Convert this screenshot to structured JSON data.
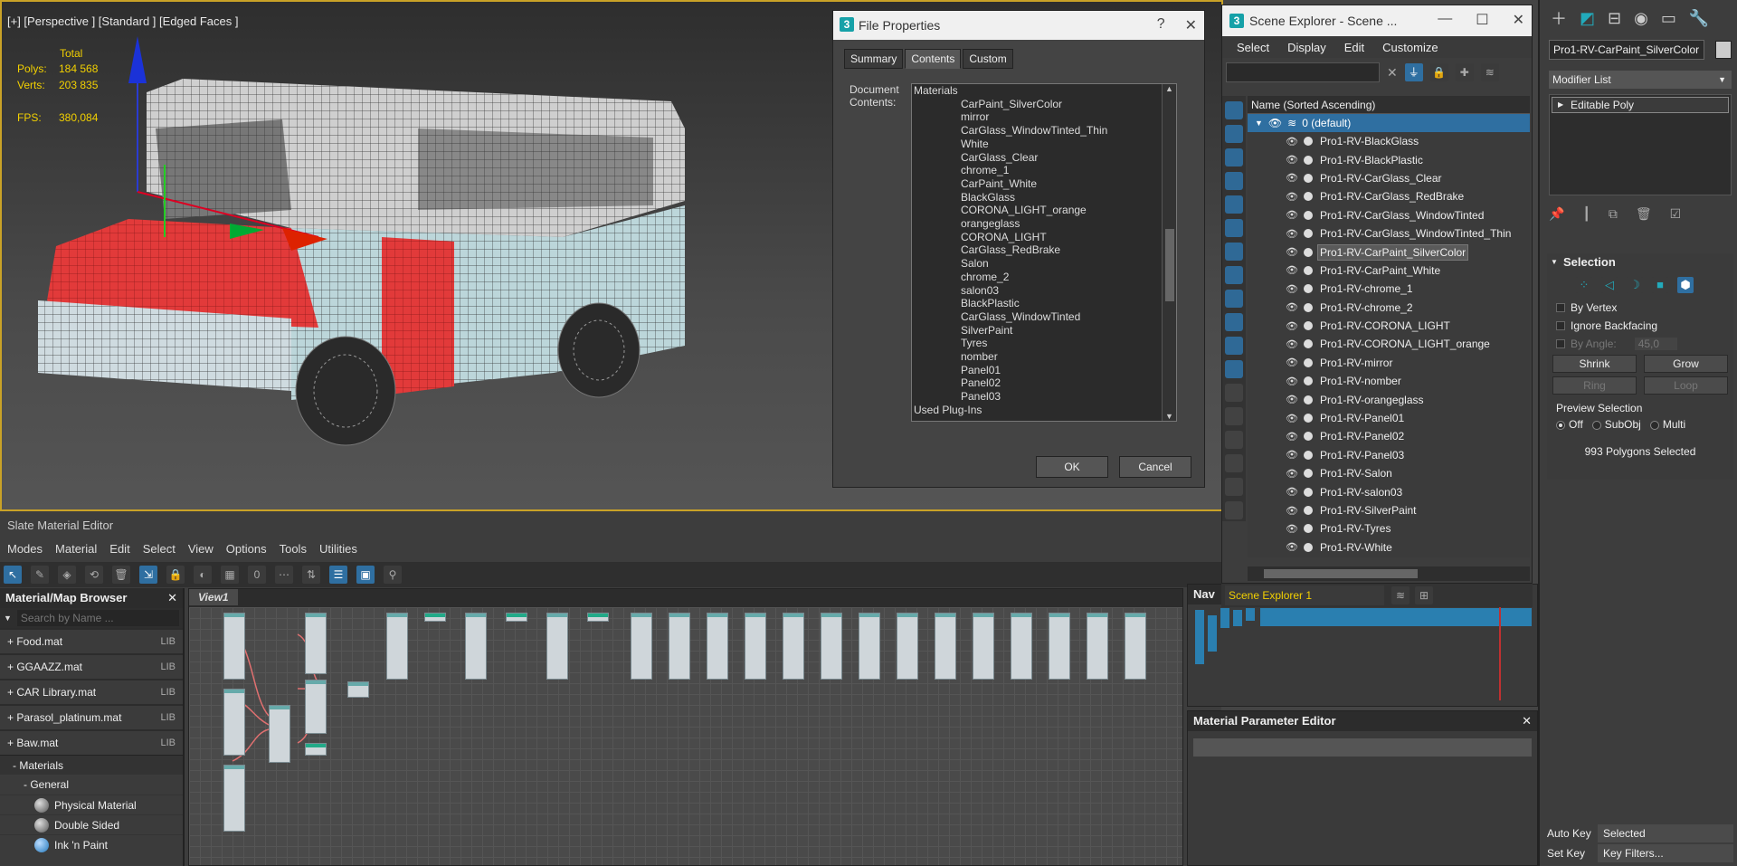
{
  "viewport": {
    "label": "[+] [Perspective ] [Standard ] [Edged Faces ]",
    "stats": {
      "total_label": "Total",
      "polys_label": "Polys:",
      "polys": "184 568",
      "verts_label": "Verts:",
      "verts": "203 835",
      "fps_label": "FPS:",
      "fps": "380,084"
    }
  },
  "file_properties": {
    "title": "File Properties",
    "help": "?",
    "close": "✕",
    "tabs": [
      "Summary",
      "Contents",
      "Custom"
    ],
    "active_tab": "Contents",
    "doc_label": "Document Contents:",
    "items": [
      {
        "text": "Materials",
        "kind": "head"
      },
      {
        "text": "CarPaint_SilverColor",
        "kind": "child"
      },
      {
        "text": "mirror",
        "kind": "child"
      },
      {
        "text": "CarGlass_WindowTinted_Thin",
        "kind": "child"
      },
      {
        "text": "White",
        "kind": "child"
      },
      {
        "text": "CarGlass_Clear",
        "kind": "child"
      },
      {
        "text": "chrome_1",
        "kind": "child"
      },
      {
        "text": "CarPaint_White",
        "kind": "child"
      },
      {
        "text": "BlackGlass",
        "kind": "child"
      },
      {
        "text": "CORONA_LIGHT_orange",
        "kind": "child"
      },
      {
        "text": "orangeglass",
        "kind": "child"
      },
      {
        "text": "CORONA_LIGHT",
        "kind": "child"
      },
      {
        "text": "CarGlass_RedBrake",
        "kind": "child"
      },
      {
        "text": "Salon",
        "kind": "child"
      },
      {
        "text": "chrome_2",
        "kind": "child"
      },
      {
        "text": "salon03",
        "kind": "child"
      },
      {
        "text": "BlackPlastic",
        "kind": "child"
      },
      {
        "text": "CarGlass_WindowTinted",
        "kind": "child"
      },
      {
        "text": "SilverPaint",
        "kind": "child"
      },
      {
        "text": "Tyres",
        "kind": "child"
      },
      {
        "text": "nomber",
        "kind": "child"
      },
      {
        "text": "Panel01",
        "kind": "child"
      },
      {
        "text": "Panel02",
        "kind": "child"
      },
      {
        "text": "Panel03",
        "kind": "child"
      },
      {
        "text": "Used Plug-Ins",
        "kind": "head"
      }
    ],
    "ok": "OK",
    "cancel": "Cancel"
  },
  "slate": {
    "title": "Slate Material Editor",
    "menu": [
      "Modes",
      "Material",
      "Edit",
      "Select",
      "View",
      "Options",
      "Tools",
      "Utilities"
    ],
    "browser": {
      "title": "Material/Map Browser",
      "close": "✕",
      "search_placeholder": "Search by Name ...",
      "libraries": [
        {
          "name": "+ Food.mat",
          "tag": "LIB"
        },
        {
          "name": "+ GGAAZZ.mat",
          "tag": "LIB"
        },
        {
          "name": "+ CAR Library.mat",
          "tag": "LIB"
        },
        {
          "name": "+ Parasol_platinum.mat",
          "tag": "LIB"
        },
        {
          "name": "+ Baw.mat",
          "tag": "LIB"
        }
      ],
      "materials_label": "- Materials",
      "general_label": "- General",
      "materials": [
        "Physical Material",
        "Double Sided",
        "Ink 'n Paint"
      ]
    },
    "view_tab": "View1",
    "nav_label": "Nav",
    "mpe_title": "Material Parameter Editor",
    "mpe_close": "✕"
  },
  "scene_explorer": {
    "title": "Scene Explorer - Scene ...",
    "menu": [
      "Select",
      "Display",
      "Edit",
      "Customize"
    ],
    "column_header": "Name (Sorted Ascending)",
    "root": "0 (default)",
    "objects": [
      "Pro1-RV-BlackGlass",
      "Pro1-RV-BlackPlastic",
      "Pro1-RV-CarGlass_Clear",
      "Pro1-RV-CarGlass_RedBrake",
      "Pro1-RV-CarGlass_WindowTinted",
      "Pro1-RV-CarGlass_WindowTinted_Thin",
      "Pro1-RV-CarPaint_SilverColor",
      "Pro1-RV-CarPaint_White",
      "Pro1-RV-chrome_1",
      "Pro1-RV-chrome_2",
      "Pro1-RV-CORONA_LIGHT",
      "Pro1-RV-CORONA_LIGHT_orange",
      "Pro1-RV-mirror",
      "Pro1-RV-nomber",
      "Pro1-RV-orangeglass",
      "Pro1-RV-Panel01",
      "Pro1-RV-Panel02",
      "Pro1-RV-Panel03",
      "Pro1-RV-Salon",
      "Pro1-RV-salon03",
      "Pro1-RV-SilverPaint",
      "Pro1-RV-Tyres",
      "Pro1-RV-White"
    ],
    "selected": "Pro1-RV-CarPaint_SilverColor",
    "dock_label": "Scene Explorer 1"
  },
  "command_panel": {
    "object_name": "Pro1-RV-CarPaint_SilverColor",
    "modifier_list": "Modifier List",
    "stack_item": "Editable Poly",
    "selection": {
      "title": "Selection",
      "by_vertex": "By Vertex",
      "ignore_backfacing": "Ignore Backfacing",
      "by_angle": "By Angle:",
      "angle": "45,0",
      "shrink": "Shrink",
      "grow": "Grow",
      "ring": "Ring",
      "loop": "Loop",
      "preview_label": "Preview Selection",
      "off": "Off",
      "subobj": "SubObj",
      "multi": "Multi",
      "count": "993 Polygons Selected"
    },
    "auto_key": "Auto Key",
    "set_key": "Set Key",
    "key_mode": "Selected",
    "key_filters": "Key Filters..."
  },
  "colors": {
    "accent": "#2f6fa1",
    "viewport_border": "#c9a227",
    "stats": "#f2d000",
    "red_paint": "#e23a3a",
    "glass": "#bcd6da"
  }
}
